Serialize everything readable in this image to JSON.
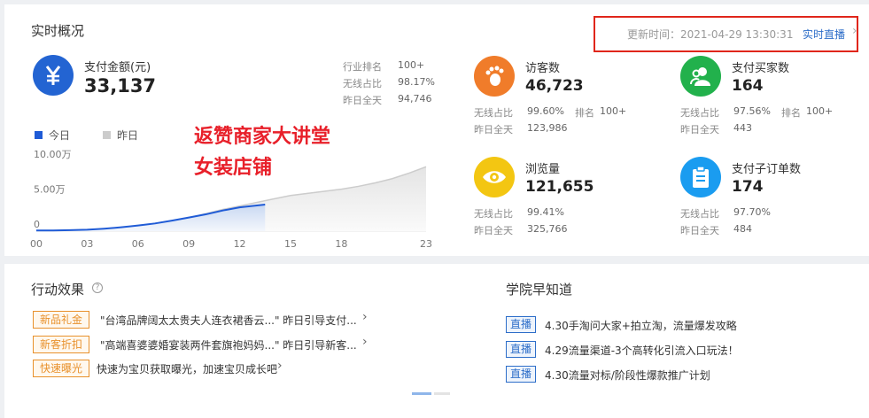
{
  "realtime": {
    "title": "实时概况",
    "update_time": "更新时间：2021-04-29 13:30:31",
    "live_link": "实时直播",
    "chevron": "›"
  },
  "payment": {
    "icon": "yen-icon",
    "label": "支付金额(元)",
    "value": "33,137",
    "rank_label": "行业排名",
    "rank_value": "100+",
    "online_label": "无线占比",
    "online_value": "98.17%",
    "yesterday_label": "昨日全天",
    "yesterday_value": "94,746"
  },
  "chart_data": {
    "type": "area",
    "series": [
      {
        "name": "今日",
        "color": "#1f5bd6",
        "x": [
          0,
          1,
          2,
          3,
          4,
          5,
          6,
          7,
          8,
          9,
          10,
          11,
          12,
          13.5
        ],
        "y": [
          0.1,
          0.1,
          0.15,
          0.2,
          0.35,
          0.55,
          0.8,
          1.1,
          1.5,
          1.95,
          2.4,
          2.95,
          3.4,
          3.8
        ]
      },
      {
        "name": "昨日",
        "color": "#cccccc",
        "x": [
          0,
          1,
          2,
          3,
          4,
          5,
          6,
          7,
          8,
          9,
          10,
          11,
          12,
          13,
          14,
          15,
          16,
          17,
          18,
          19,
          20,
          21,
          22,
          23
        ],
        "y": [
          0.1,
          0.1,
          0.15,
          0.2,
          0.3,
          0.5,
          0.7,
          1.0,
          1.4,
          1.9,
          2.5,
          3.1,
          3.6,
          4.1,
          4.6,
          5.1,
          5.4,
          5.7,
          6.0,
          6.4,
          6.9,
          7.5,
          8.3,
          9.2
        ]
      }
    ],
    "legend": [
      "今日",
      "昨日"
    ],
    "y_ticks": [
      "10.00万",
      "5.00万",
      "0"
    ],
    "x_ticks": [
      "00",
      "03",
      "06",
      "09",
      "12",
      "15",
      "18",
      "23"
    ],
    "ylim": [
      0,
      10
    ],
    "xlim": [
      0,
      23
    ]
  },
  "overlay": {
    "line1": "返赞商家大讲堂",
    "line2": "女装店铺"
  },
  "metrics": [
    {
      "name": "visitors",
      "icon": "footprint-icon",
      "color": "#f07c2a",
      "label": "访客数",
      "value": "46,723",
      "l1": "无线占比",
      "v1": "99.60%",
      "l1b": "排名",
      "v1b": "100+",
      "l2": "昨日全天",
      "v2": "123,986"
    },
    {
      "name": "buyers",
      "icon": "users-icon",
      "color": "#22b14c",
      "label": "支付买家数",
      "value": "164",
      "l1": "无线占比",
      "v1": "97.56%",
      "l1b": "排名",
      "v1b": "100+",
      "l2": "昨日全天",
      "v2": "443"
    },
    {
      "name": "pageviews",
      "icon": "eye-icon",
      "color": "#f3c612",
      "label": "浏览量",
      "value": "121,655",
      "l1": "无线占比",
      "v1": "99.41%",
      "l2": "昨日全天",
      "v2": "325,766"
    },
    {
      "name": "suborders",
      "icon": "clipboard-icon",
      "color": "#1a9cf0",
      "label": "支付子订单数",
      "value": "174",
      "l1": "无线占比",
      "v1": "97.70%",
      "l2": "昨日全天",
      "v2": "484"
    }
  ],
  "action": {
    "title": "行动效果",
    "help_icon": "help-icon",
    "rows": [
      {
        "tag": "新品礼金",
        "text": "\"台湾品牌阔太太贵夫人连衣裙香云...\" 昨日引导支付...",
        "chev": "›"
      },
      {
        "tag": "新客折扣",
        "text": "\"高端喜婆婆婚宴装两件套旗袍妈妈...\" 昨日引导新客...",
        "chev": "›"
      },
      {
        "tag": "快速曝光",
        "text": "快速为宝贝获取曝光，加速宝贝成长吧",
        "chev": "›"
      }
    ]
  },
  "academy": {
    "title": "学院早知道",
    "items": [
      {
        "tag": "直播",
        "text": "4.30手淘问大家+拍立淘，流量爆发攻略"
      },
      {
        "tag": "直播",
        "text": "4.29流量渠道-3个高转化引流入口玩法！"
      },
      {
        "tag": "直播",
        "text": "4.30流量对标/阶段性爆款推广计划"
      }
    ]
  }
}
